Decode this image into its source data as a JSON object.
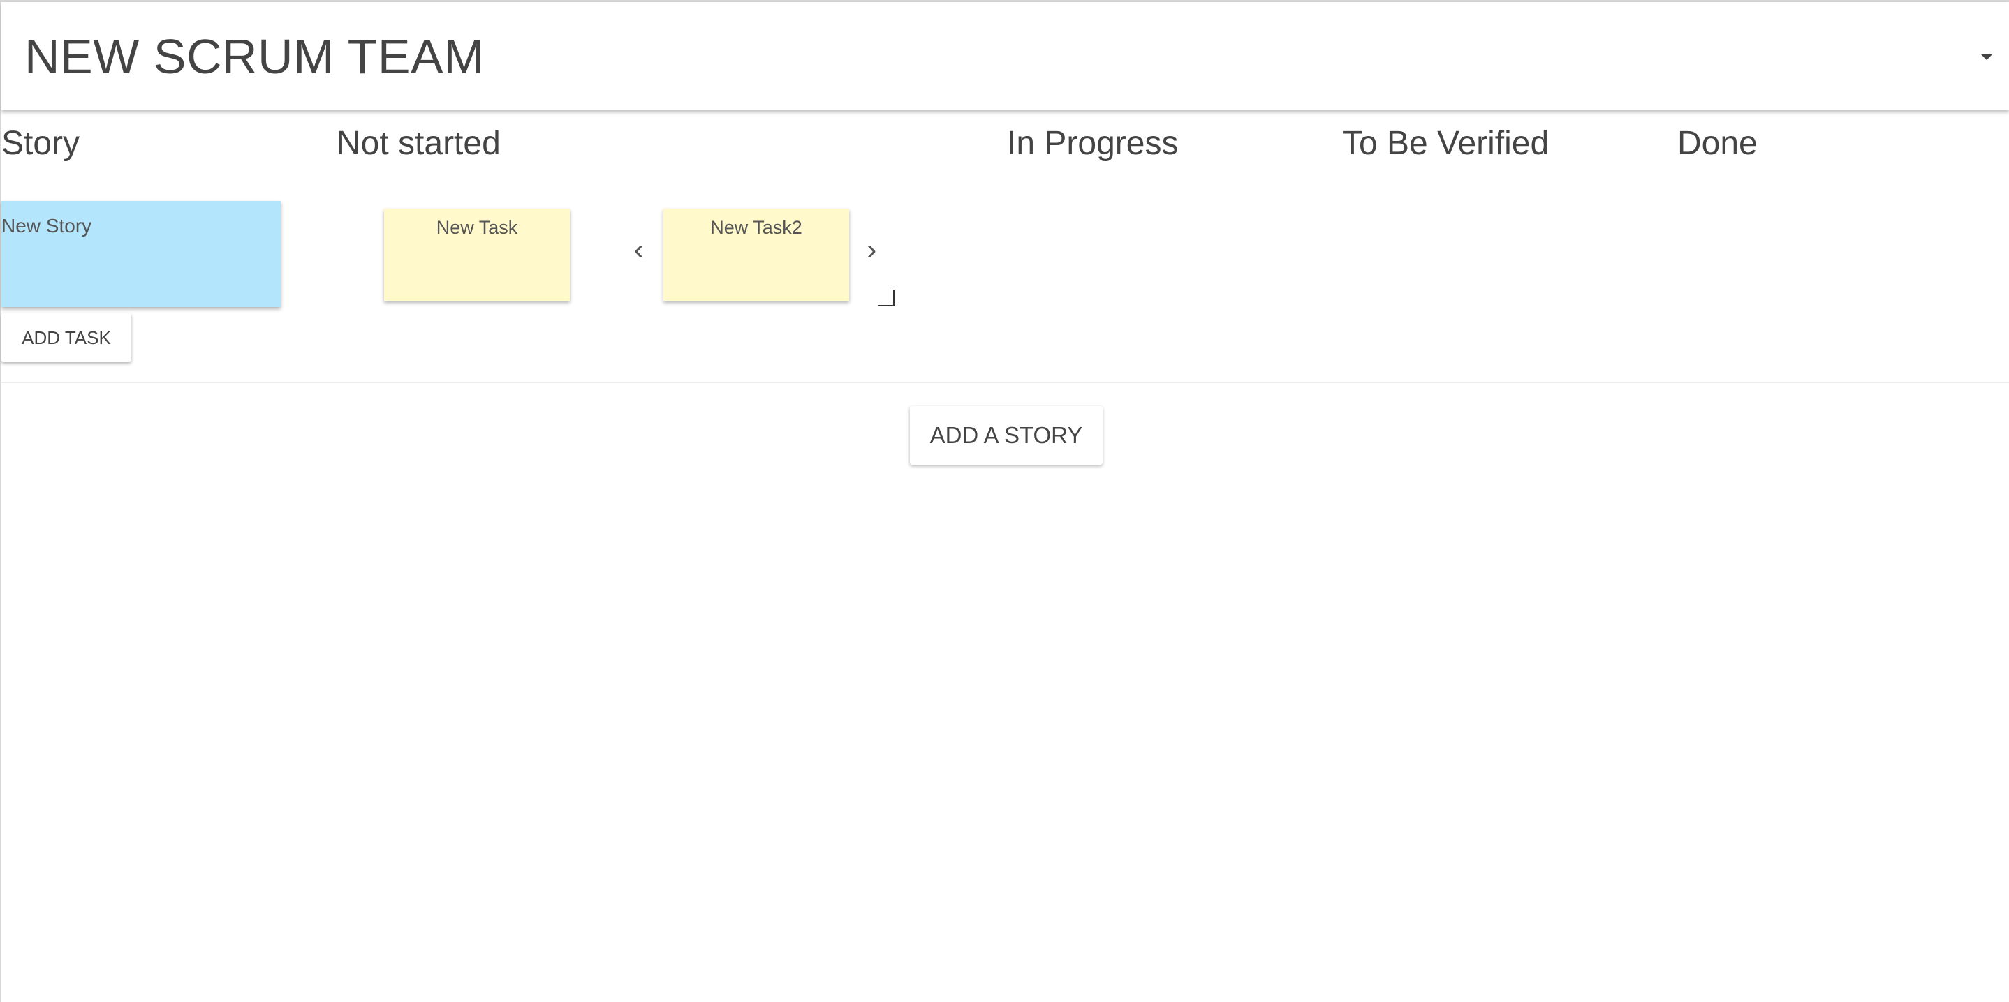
{
  "header": {
    "team_name": "NEW SCRUM TEAM"
  },
  "columns": {
    "story": "Story",
    "not_started": "Not started",
    "in_progress": "In Progress",
    "to_be_verified": "To Be Verified",
    "done": "Done"
  },
  "story": {
    "title": "New Story",
    "color": "#b3e5fc"
  },
  "tasks": [
    {
      "title": "New Task",
      "color": "#fff9cc"
    },
    {
      "title": "New Task2",
      "color": "#fff9cc"
    }
  ],
  "icons": {
    "prev": "chevron-left-icon",
    "next": "chevron-right-icon",
    "dropdown": "caret-down-icon",
    "resize": "resize-handle-icon"
  },
  "buttons": {
    "add_task": "ADD TASK",
    "add_story": "ADD A STORY"
  }
}
